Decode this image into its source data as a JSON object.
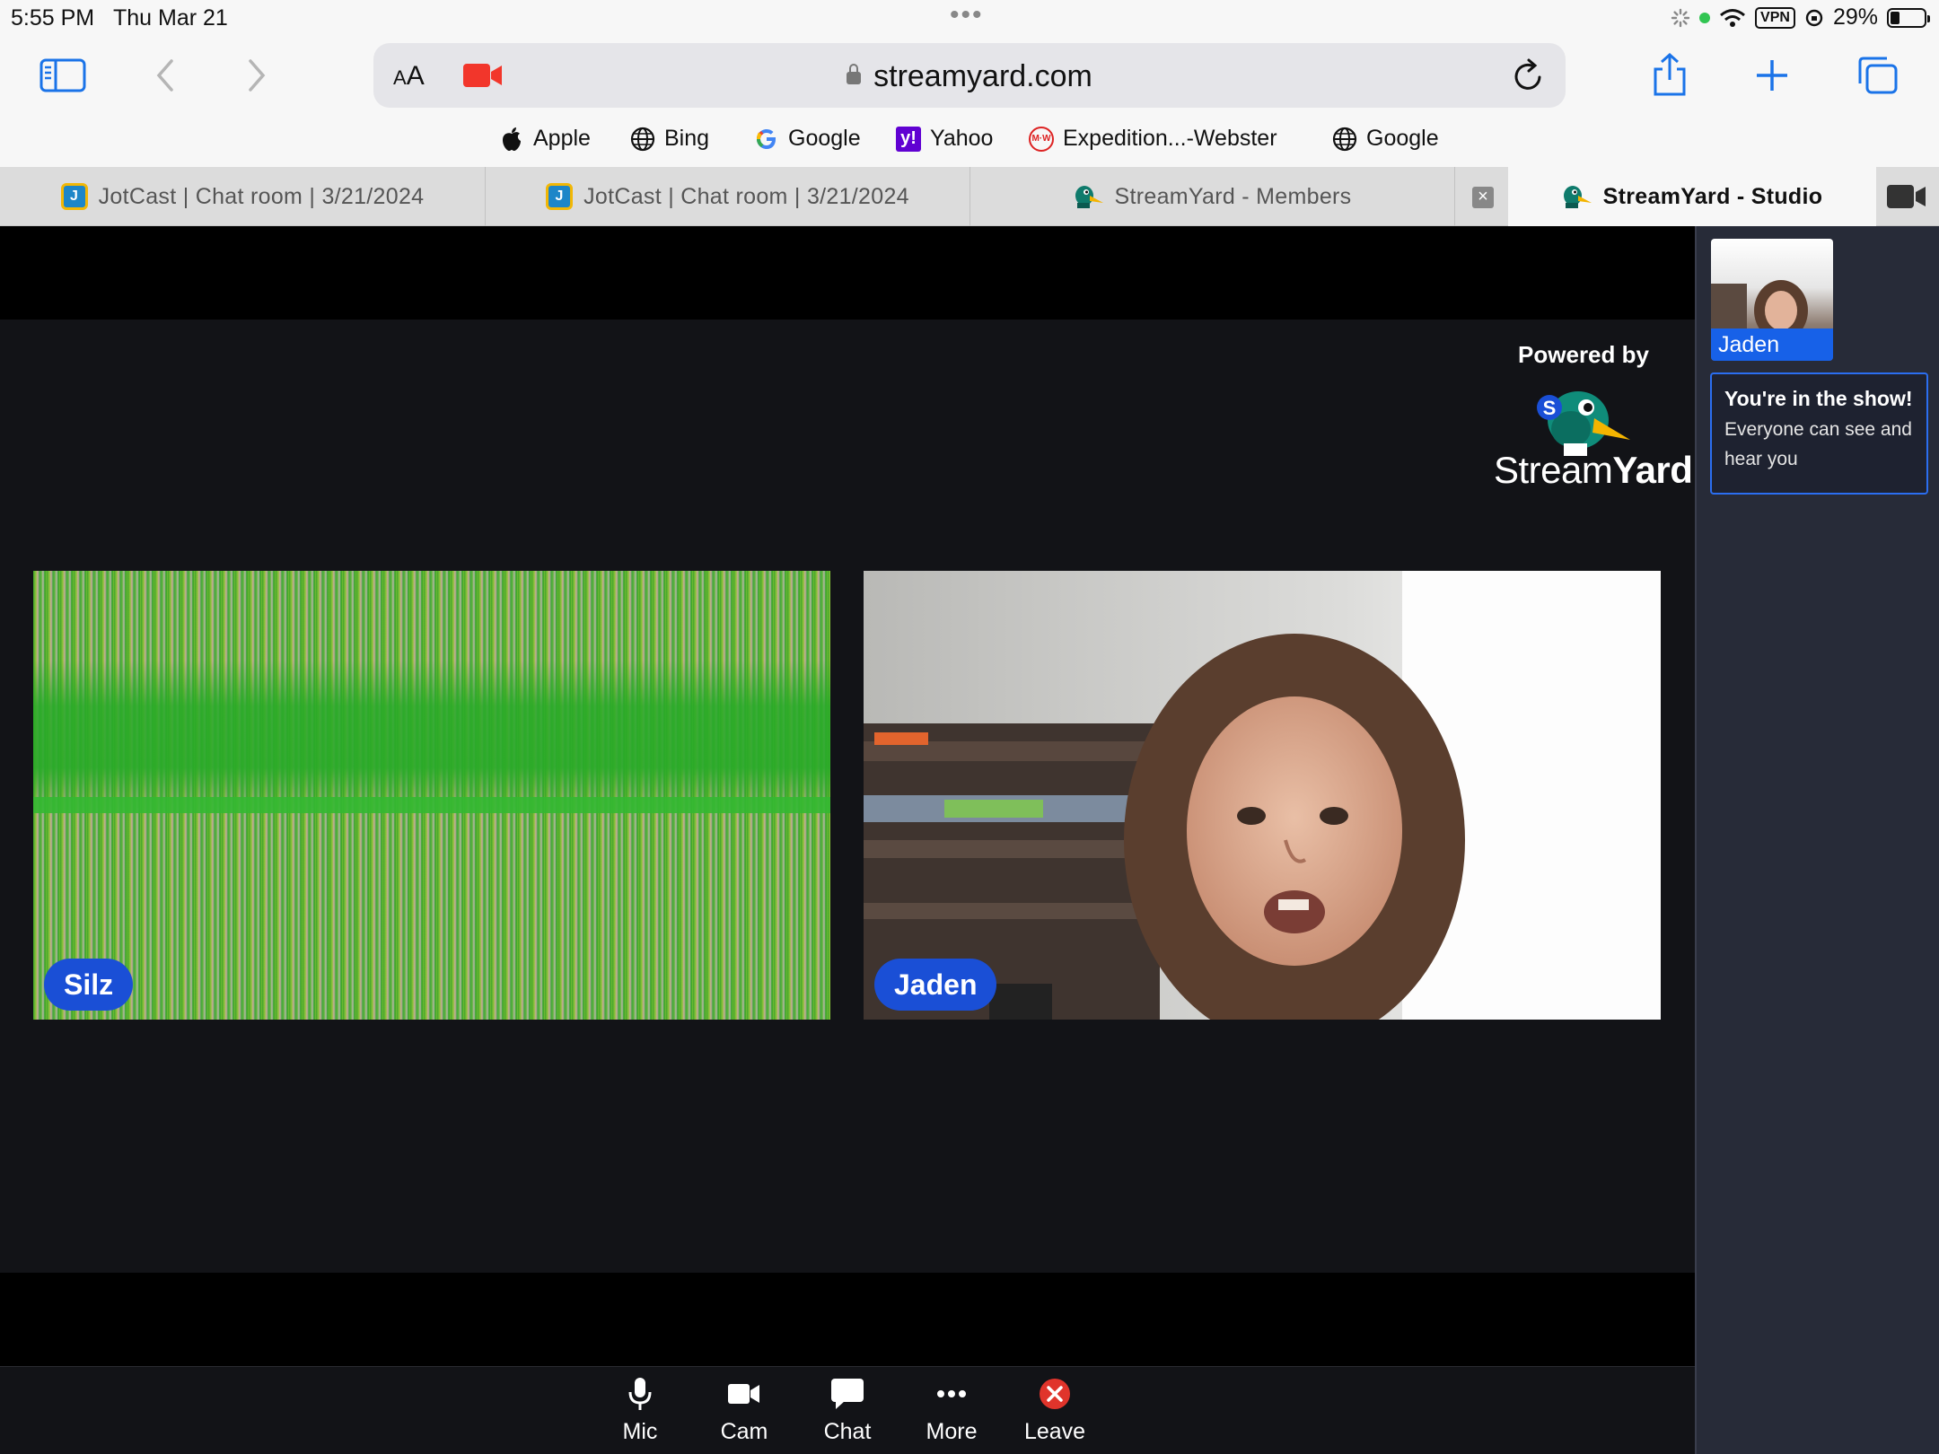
{
  "status_bar": {
    "time": "5:55 PM",
    "date": "Thu Mar 21",
    "vpn": "VPN",
    "battery": "29%",
    "battery_level": 0.29
  },
  "toolbar": {
    "text_size_label_small": "A",
    "text_size_label_large": "A",
    "url": "streamyard.com"
  },
  "favorites": [
    {
      "label": "Apple",
      "icon": "apple-icon"
    },
    {
      "label": "Bing",
      "icon": "globe-icon"
    },
    {
      "label": "Google",
      "icon": "google-icon"
    },
    {
      "label": "Yahoo",
      "icon": "yahoo-icon"
    },
    {
      "label": "Expedition...-Webster",
      "icon": "merriam-webster-icon"
    },
    {
      "label": "Google",
      "icon": "globe-icon"
    }
  ],
  "tabs": [
    {
      "label": "JotCast | Chat room | 3/21/2024",
      "active": false
    },
    {
      "label": "JotCast | Chat room | 3/21/2024",
      "active": false
    },
    {
      "label": "StreamYard - Members",
      "active": false
    },
    {
      "label": "StreamYard - Studio",
      "active": true
    }
  ],
  "studio": {
    "powered_by": "Powered by",
    "brand_light": "Stream",
    "brand_bold": "Yard",
    "participants": [
      {
        "name": "Silz"
      },
      {
        "name": "Jaden"
      }
    ]
  },
  "controls": [
    {
      "label": "Mic",
      "icon": "mic-icon"
    },
    {
      "label": "Cam",
      "icon": "camera-icon"
    },
    {
      "label": "Chat",
      "icon": "chat-icon"
    },
    {
      "label": "More",
      "icon": "more-icon"
    },
    {
      "label": "Leave",
      "icon": "leave-icon"
    }
  ],
  "panel": {
    "self_name": "Jaden",
    "notice_title": "You're in the show!",
    "notice_text": "Everyone can see and hear you"
  },
  "colors": {
    "name_pill": "#1a4fd6",
    "leave": "#e0342b",
    "record": "#f2362b",
    "accent_blue": "#1a73e8"
  }
}
